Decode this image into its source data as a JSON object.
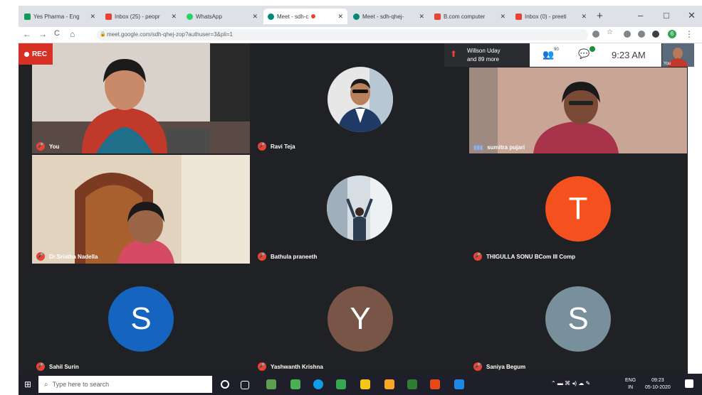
{
  "browser": {
    "tabs": [
      {
        "label": "Yes Pharma - Eng",
        "favicon_color": "#0f9d58"
      },
      {
        "label": "Inbox (25) - peopr",
        "favicon_color": "#ea4335"
      },
      {
        "label": "WhatsApp",
        "favicon_color": "#25d366"
      },
      {
        "label": "Meet - sdh-c",
        "favicon_color": "#00897b"
      },
      {
        "label": "Meet - sdh-qhej-",
        "favicon_color": "#00897b"
      },
      {
        "label": "B.com computer",
        "favicon_color": "#ea4335"
      },
      {
        "label": "Inbox (0) - preeti",
        "favicon_color": "#ea4335"
      }
    ],
    "active_tab_index": 3,
    "new_tab": "+",
    "window_controls": [
      "–",
      "□",
      "✕"
    ],
    "nav": {
      "back": "←",
      "forward": "→",
      "reload": "C",
      "home": "⌂"
    },
    "url": "meet.google.com/sdh-qhej-zop?authuser=3&pli=1",
    "profile_initial": "6"
  },
  "meet": {
    "rec_label": "REC",
    "presenter_line1": "Willson Uday",
    "presenter_line2": "and 89 more",
    "participants_count": "90",
    "time": "9:23 AM",
    "self_label": "You",
    "tiles": [
      {
        "name": "You",
        "type": "video"
      },
      {
        "name": "Ravi Teja",
        "type": "photo"
      },
      {
        "name": "sumitra pujari",
        "type": "video"
      },
      {
        "name": "Dr.Sriatha Nadella",
        "type": "video"
      },
      {
        "name": "Bathula praneeth",
        "type": "photo"
      },
      {
        "name": "THIGULLA SONU BCom III Comp",
        "type": "letter",
        "letter": "T",
        "color": "#f4511e"
      },
      {
        "name": "Sahil Surin",
        "type": "letter",
        "letter": "S",
        "color": "#1565c0"
      },
      {
        "name": "Yashwanth Krishna",
        "type": "letter",
        "letter": "Y",
        "color": "#795548"
      },
      {
        "name": "Saniya Begum",
        "type": "letter",
        "letter": "S",
        "color": "#78909c"
      }
    ]
  },
  "taskbar": {
    "search_placeholder": "Type here to search",
    "lang_line1": "ENG",
    "lang_line2": "IN",
    "clock_time": "09:23",
    "clock_date": "05-10-2020"
  }
}
